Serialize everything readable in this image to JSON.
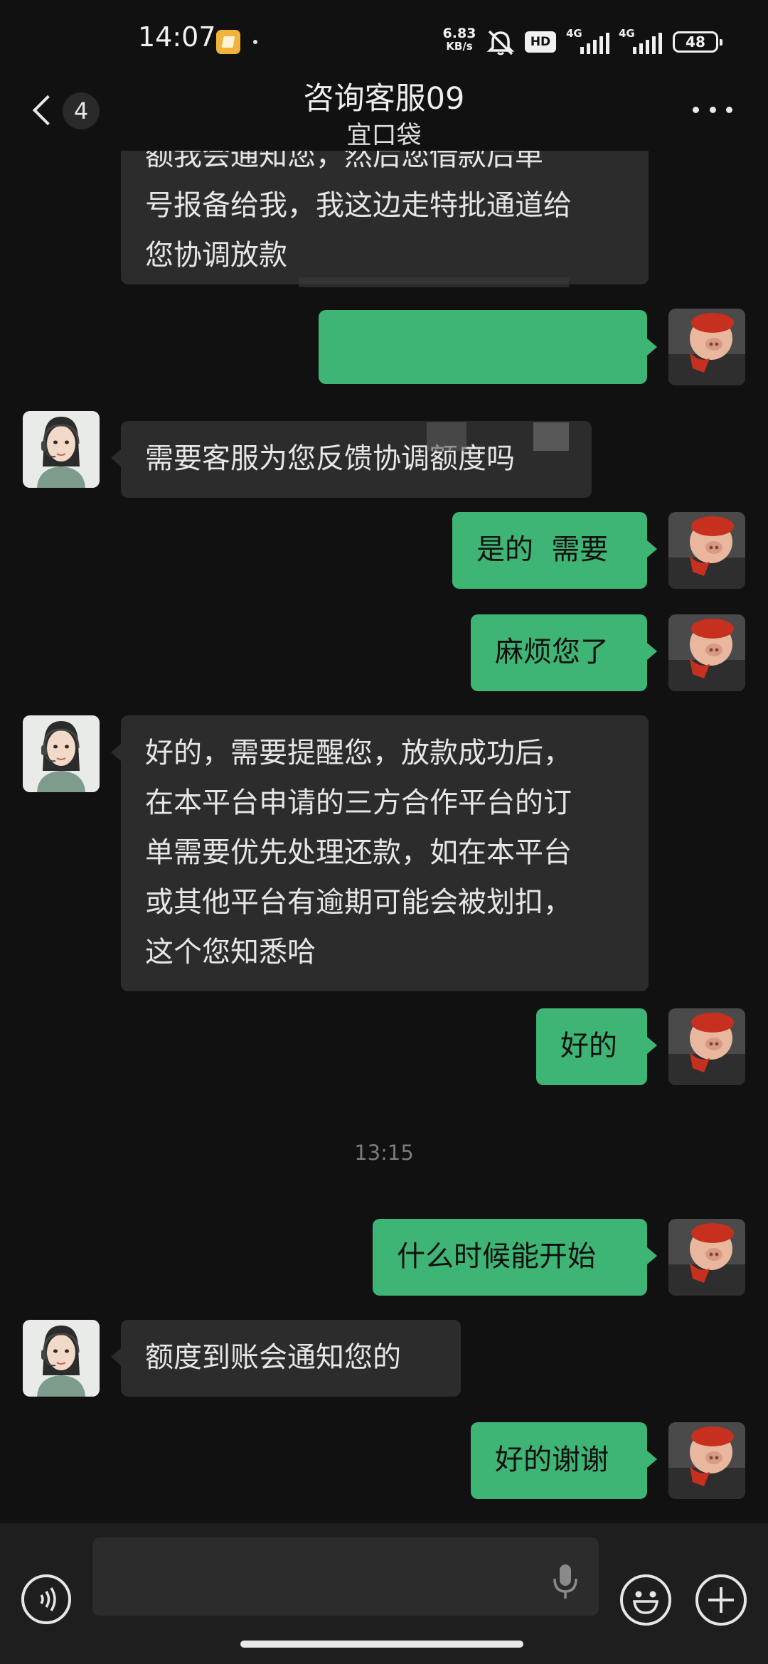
{
  "status_bar": {
    "time": "14:07",
    "net_speed_value": "6.83",
    "net_speed_unit": "KB/s",
    "hd_label": "HD",
    "signal_1": "4G",
    "signal_2": "4G",
    "battery": "48"
  },
  "header": {
    "unread_count": "4",
    "title": "咨询客服09",
    "subtitle": "宜口袋"
  },
  "messages": [
    {
      "side": "incoming",
      "text": "额我会通知您，然后您借款后单\n号报备给我，我这边走特批通道给\n您协调放款"
    },
    {
      "side": "outgoing",
      "text": ""
    },
    {
      "side": "incoming",
      "text": "需要客服为您反馈协调额度吗"
    },
    {
      "side": "outgoing",
      "text": "是的  需要"
    },
    {
      "side": "outgoing",
      "text": "麻烦您了"
    },
    {
      "side": "incoming",
      "text": "好的，需要提醒您，放款成功后，\n在本平台申请的三方合作平台的订\n单需要优先处理还款，如在本平台\n或其他平台有逾期可能会被划扣，\n这个您知悉哈"
    },
    {
      "side": "outgoing",
      "text": "好的"
    },
    {
      "side": "outgoing",
      "text": "什么时候能开始"
    },
    {
      "side": "incoming",
      "text": "额度到账会通知您的"
    },
    {
      "side": "outgoing",
      "text": "好的谢谢"
    }
  ],
  "time_separator": "13:15",
  "input_bar": {
    "placeholder": ""
  },
  "colors": {
    "background": "#111111",
    "incoming_bubble": "#2c2c2c",
    "outgoing_bubble": "#3eb575",
    "input_bar": "#1e1e1e"
  },
  "icons": [
    "back-chevron-icon",
    "more-dots-icon",
    "voice-icon",
    "microphone-icon",
    "emoji-icon",
    "plus-icon",
    "mute-icon"
  ]
}
